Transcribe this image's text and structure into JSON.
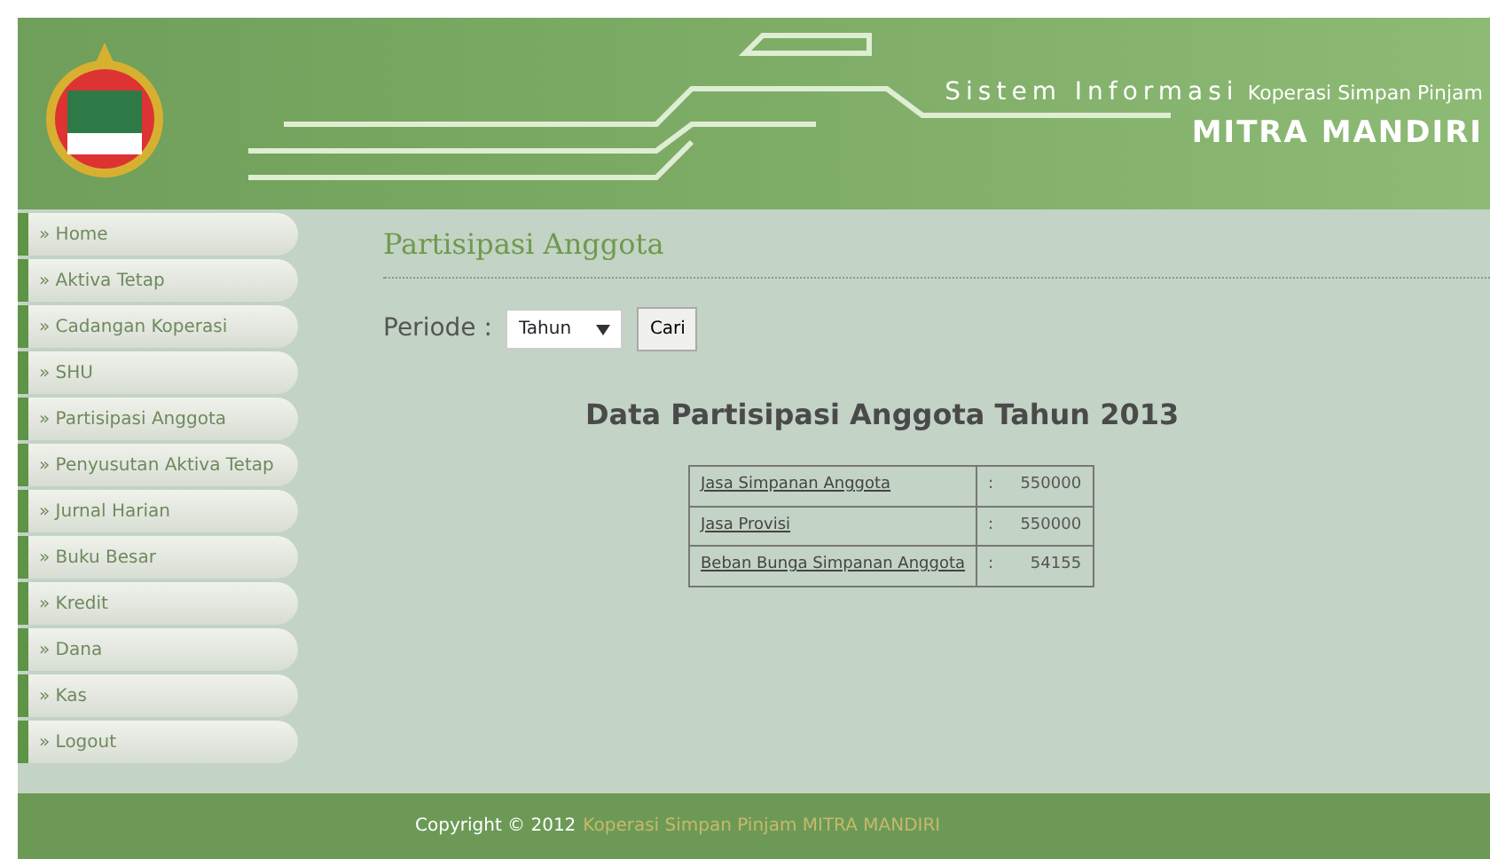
{
  "header": {
    "title": "Sistem Informasi",
    "subtitle": "Koperasi Simpan Pinjam",
    "name": "MITRA MANDIRI"
  },
  "sidebar": {
    "items": [
      {
        "label": "» Home"
      },
      {
        "label": "» Aktiva Tetap"
      },
      {
        "label": "» Cadangan Koperasi"
      },
      {
        "label": "» SHU"
      },
      {
        "label": "» Partisipasi Anggota"
      },
      {
        "label": "» Penyusutan Aktiva Tetap"
      },
      {
        "label": "» Jurnal Harian"
      },
      {
        "label": "» Buku Besar"
      },
      {
        "label": "» Kredit"
      },
      {
        "label": "» Dana"
      },
      {
        "label": "» Kas"
      },
      {
        "label": "» Logout"
      }
    ]
  },
  "content": {
    "heading": "Partisipasi Anggota",
    "filter_label": "Periode :",
    "period_select": {
      "value": "Tahun"
    },
    "search_button": "Cari",
    "table_title": "Data Partisipasi Anggota Tahun 2013",
    "rows": [
      {
        "label": "Jasa Simpanan Anggota",
        "separator": ":",
        "value": "550000"
      },
      {
        "label": "Jasa Provisi",
        "separator": ":",
        "value": "550000"
      },
      {
        "label": "Beban Bunga Simpanan Anggota",
        "separator": ":",
        "value": "54155"
      }
    ]
  },
  "footer": {
    "copyright": "Copyright © 2012",
    "owner": "Koperasi Simpan Pinjam MITRA MANDIRI"
  }
}
